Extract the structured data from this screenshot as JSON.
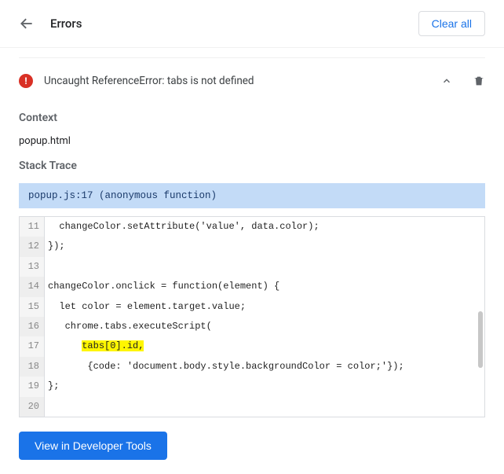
{
  "header": {
    "title": "Errors",
    "clear_all": "Clear all"
  },
  "error": {
    "message": "Uncaught ReferenceError: tabs is not defined"
  },
  "sections": {
    "context_label": "Context",
    "context_value": "popup.html",
    "stack_trace_label": "Stack Trace",
    "trace_header": "popup.js:17 (anonymous function)"
  },
  "code": {
    "lines": [
      {
        "n": "11",
        "text": "  changeColor.setAttribute('value', data.color);"
      },
      {
        "n": "12",
        "text": "});"
      },
      {
        "n": "13",
        "text": ""
      },
      {
        "n": "14",
        "text": "changeColor.onclick = function(element) {"
      },
      {
        "n": "15",
        "text": "  let color = element.target.value;"
      },
      {
        "n": "16",
        "text": "   chrome.tabs.executeScript("
      },
      {
        "n": "17",
        "pre": "      ",
        "hl": "tabs[0].id,",
        "post": ""
      },
      {
        "n": "18",
        "text": "       {code: 'document.body.style.backgroundColor = color;'});"
      },
      {
        "n": "19",
        "text": "};"
      },
      {
        "n": "20",
        "text": ""
      }
    ]
  },
  "actions": {
    "view_devtools": "View in Developer Tools"
  }
}
